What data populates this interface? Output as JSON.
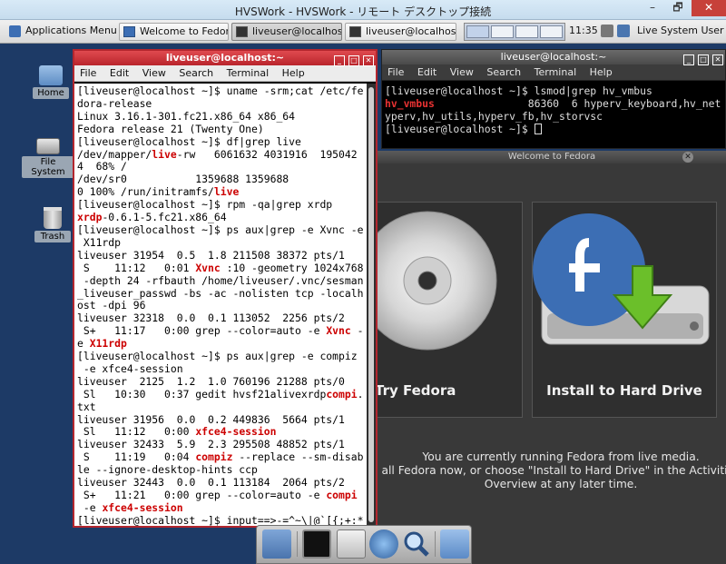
{
  "window": {
    "title": "HVSWork - HVSWork - リモート デスクトップ接続",
    "minimize": "–",
    "maximize": "🗗",
    "close": "✕"
  },
  "panel": {
    "apps_menu": "Applications Menu",
    "tasks": [
      {
        "label": "Welcome to Fedora"
      },
      {
        "label": "liveuser@localhos..."
      },
      {
        "label": "liveuser@localhos..."
      }
    ],
    "clock": "11:35",
    "user": "Live System User"
  },
  "desktop": {
    "icons": [
      {
        "label": "Home"
      },
      {
        "label": "File System"
      },
      {
        "label": "Trash"
      }
    ]
  },
  "terminal1": {
    "title": "liveuser@localhost:~",
    "menu": [
      "File",
      "Edit",
      "View",
      "Search",
      "Terminal",
      "Help"
    ],
    "lines": [
      [
        {
          "t": "[liveuser@localhost ~]$ uname -srm;cat /etc/fe"
        }
      ],
      [
        {
          "t": "dora-release"
        }
      ],
      [
        {
          "t": "Linux 3.16.1-301.fc21.x86_64 x86_64"
        }
      ],
      [
        {
          "t": "Fedora release 21 (Twenty One)"
        }
      ],
      [
        {
          "t": "[liveuser@localhost ~]$ df|grep live"
        }
      ],
      [
        {
          "t": "/dev/mapper/"
        },
        {
          "t": "live",
          "h": 1
        },
        {
          "t": "-rw   6061632 4031916  195042"
        }
      ],
      [
        {
          "t": "4  68% /"
        }
      ],
      [
        {
          "t": "/dev/sr0           1359688 1359688"
        }
      ],
      [
        {
          "t": "0 100% /run/initramfs/"
        },
        {
          "t": "live",
          "h": 1
        }
      ],
      [
        {
          "t": "[liveuser@localhost ~]$ rpm -qa|grep xrdp"
        }
      ],
      [
        {
          "t": "xrdp",
          "h": 1
        },
        {
          "t": "-0.6.1-5.fc21.x86_64"
        }
      ],
      [
        {
          "t": "[liveuser@localhost ~]$ ps aux|grep -e Xvnc -e"
        }
      ],
      [
        {
          "t": " X11rdp"
        }
      ],
      [
        {
          "t": "liveuser 31954  0.5  1.8 211508 38372 pts/1"
        }
      ],
      [
        {
          "t": " S    11:12   0:01 "
        },
        {
          "t": "Xvnc",
          "h": 1
        },
        {
          "t": " :10 -geometry 1024x768"
        }
      ],
      [
        {
          "t": " -depth 24 -rfbauth /home/liveuser/.vnc/sesman"
        }
      ],
      [
        {
          "t": "_liveuser_passwd -bs -ac -nolisten tcp -localh"
        }
      ],
      [
        {
          "t": "ost -dpi 96"
        }
      ],
      [
        {
          "t": "liveuser 32318  0.0  0.1 113052  2256 pts/2"
        }
      ],
      [
        {
          "t": " S+   11:17   0:00 grep --color=auto -e "
        },
        {
          "t": "Xvnc",
          "h": 1
        },
        {
          "t": " -"
        }
      ],
      [
        {
          "t": "e "
        },
        {
          "t": "X11rdp",
          "h": 1
        }
      ],
      [
        {
          "t": "[liveuser@localhost ~]$ ps aux|grep -e compiz"
        }
      ],
      [
        {
          "t": " -e xfce4-session"
        }
      ],
      [
        {
          "t": "liveuser  2125  1.2  1.0 760196 21288 pts/0"
        }
      ],
      [
        {
          "t": " Sl   10:30   0:37 gedit hvsf21alivexrdp"
        },
        {
          "t": "compi",
          "h": 1
        },
        {
          "t": "."
        }
      ],
      [
        {
          "t": "txt"
        }
      ],
      [
        {
          "t": "liveuser 31956  0.0  0.2 449836  5664 pts/1"
        }
      ],
      [
        {
          "t": " Sl   11:12   0:00 "
        },
        {
          "t": "xfce4-session",
          "h": 1
        }
      ],
      [
        {
          "t": "liveuser 32433  5.9  2.3 295508 48852 pts/1"
        }
      ],
      [
        {
          "t": " S    11:19   0:04 "
        },
        {
          "t": "compiz",
          "h": 1
        },
        {
          "t": " --replace --sm-disab"
        }
      ],
      [
        {
          "t": "le --ignore-desktop-hints ccp"
        }
      ],
      [
        {
          "t": "liveuser 32443  0.0  0.1 113184  2064 pts/2"
        }
      ],
      [
        {
          "t": " S+   11:21   0:00 grep --color=auto -e "
        },
        {
          "t": "compi",
          "h": 1
        }
      ],
      [
        {
          "t": " -e "
        },
        {
          "t": "xfce4-session",
          "h": 1
        }
      ],
      [
        {
          "t": "[liveuser@localhost ~]$ input==>-=^~\\|@`[{;+:*"
        }
      ]
    ]
  },
  "terminal2": {
    "title": "liveuser@localhost:~",
    "menu": [
      "File",
      "Edit",
      "View",
      "Search",
      "Terminal",
      "Help"
    ],
    "lines": [
      [
        {
          "t": "[liveuser@localhost ~]$ lsmod|grep hv_vmbus"
        }
      ],
      [
        {
          "t": "hv_vmbus",
          "h": 1
        },
        {
          "t": "               86360  6 hyperv_keyboard,hv_net"
        }
      ],
      [
        {
          "t": "yperv,hv_utils,hyperv_fb,hv_storvsc"
        }
      ],
      [
        {
          "t": "[liveuser@localhost ~]$ "
        }
      ]
    ]
  },
  "welcome": {
    "title": "Welcome to Fedora",
    "try_label": "Try Fedora",
    "install_label": "Install to Hard Drive",
    "message_lines": [
      "You are currently running Fedora from live media.",
      "all Fedora now, or choose \"Install to Hard Drive\" in the Activities",
      "Overview at any later time."
    ]
  },
  "dock": {
    "items": [
      "files-icon",
      "terminal-icon",
      "file-manager-icon",
      "web-browser-icon",
      "search-icon",
      "folder-icon"
    ]
  },
  "colors": {
    "terminal_highlight": "#cc0000",
    "fedora_blue": "#3c6eb4",
    "install_arrow": "#6bbf2a"
  }
}
